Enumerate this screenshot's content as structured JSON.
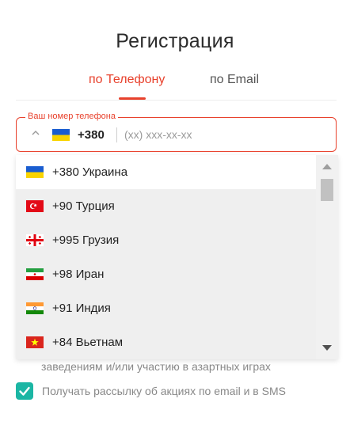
{
  "title": "Регистрация",
  "tabs": {
    "phone": "по Телефону",
    "email": "по Email"
  },
  "phone_field": {
    "legend": "Ваш номер телефона",
    "selected_code": "+380",
    "placeholder": "(хх) ххх-хх-хх",
    "selected_flag_icon": "ukraine-flag-icon"
  },
  "countries": [
    {
      "label": "+380 Украина",
      "flag": "ukraine-flag-icon"
    },
    {
      "label": "+90 Турция",
      "flag": "turkey-flag-icon"
    },
    {
      "label": "+995 Грузия",
      "flag": "georgia-flag-icon"
    },
    {
      "label": "+98 Иран",
      "flag": "iran-flag-icon"
    },
    {
      "label": "+91 Индия",
      "flag": "india-flag-icon"
    },
    {
      "label": "+84 Вьетнам",
      "flag": "vietnam-flag-icon"
    }
  ],
  "consent_text_partial": "заведениям и/или участию в азартных играх",
  "newsletter": {
    "label": "Получать рассылку об акциях по email и в SMS",
    "checked": true
  },
  "colors": {
    "accent": "#e8412c",
    "checkbox": "#1bb6a4",
    "hover_row": "#efefef"
  }
}
